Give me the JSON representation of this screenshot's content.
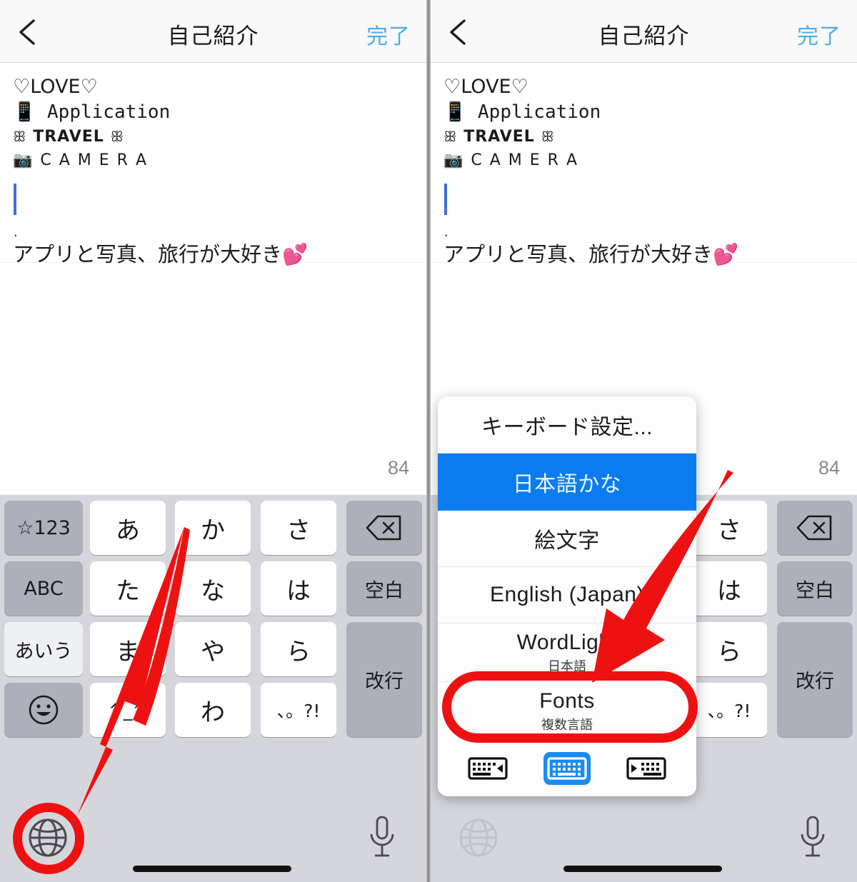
{
  "nav": {
    "back_icon": "chevron-left-icon",
    "title": "自己紹介",
    "done_label": "完了"
  },
  "bio": {
    "lines": [
      {
        "id": "love",
        "text": "♡LOVE♡"
      },
      {
        "id": "app",
        "emoji": "📱",
        "text": "Application"
      },
      {
        "id": "travel",
        "orn_left": "ꕥ",
        "text": "TRAVEL",
        "orn_right": "ꕥ"
      },
      {
        "id": "camera",
        "emoji": "📷",
        "text": "C A M E R A"
      },
      {
        "id": "blank",
        "text": ""
      },
      {
        "id": "dot",
        "text": "."
      },
      {
        "id": "jp",
        "text": "アプリと写真、旅行が大好き",
        "emoji": "💕"
      }
    ],
    "char_count": "84",
    "caret_visible": true
  },
  "keyboard": {
    "rows": [
      [
        {
          "label": "☆123",
          "style": "dark",
          "name": "key-symbols"
        },
        {
          "label": "あ",
          "style": "light",
          "name": "key-a"
        },
        {
          "label": "か",
          "style": "light",
          "name": "key-ka"
        },
        {
          "label": "さ",
          "style": "light",
          "name": "key-sa"
        },
        {
          "label": "⌫",
          "style": "dark",
          "name": "key-delete"
        }
      ],
      [
        {
          "label": "ABC",
          "style": "dark",
          "name": "key-abc"
        },
        {
          "label": "た",
          "style": "light",
          "name": "key-ta"
        },
        {
          "label": "な",
          "style": "light",
          "name": "key-na"
        },
        {
          "label": "は",
          "style": "light",
          "name": "key-ha"
        },
        {
          "label": "空白",
          "style": "dark",
          "name": "key-space"
        }
      ],
      [
        {
          "label": "あいう",
          "style": "pale",
          "name": "key-aiu"
        },
        {
          "label": "ま",
          "style": "light",
          "name": "key-ma"
        },
        {
          "label": "や",
          "style": "light",
          "name": "key-ya"
        },
        {
          "label": "ら",
          "style": "light",
          "name": "key-ra"
        },
        {
          "label": "改行",
          "style": "dark",
          "name": "key-return"
        }
      ],
      [
        {
          "label": "☺",
          "style": "dark",
          "name": "key-emoji"
        },
        {
          "label": "^_^",
          "style": "light",
          "name": "key-kaomoji"
        },
        {
          "label": "わ",
          "style": "light",
          "name": "key-wa"
        },
        {
          "label": "、。?!",
          "style": "light",
          "name": "key-punctuation"
        }
      ]
    ],
    "globe_icon": "globe-icon",
    "mic_icon": "microphone-icon",
    "home_indicator": "home-indicator"
  },
  "popup": {
    "items": [
      {
        "title": "キーボード設定...",
        "sub": "",
        "selected": false,
        "name": "menu-keyboard-settings"
      },
      {
        "title": "日本語かな",
        "sub": "",
        "selected": true,
        "name": "menu-japanese-kana"
      },
      {
        "title": "絵文字",
        "sub": "",
        "selected": false,
        "name": "menu-emoji"
      },
      {
        "title": "English (Japan)",
        "sub": "",
        "selected": false,
        "name": "menu-english-japan"
      },
      {
        "title": "WordLight",
        "sub": "日本語",
        "selected": false,
        "name": "menu-wordlight"
      },
      {
        "title": "Fonts",
        "sub": "複数言語",
        "selected": false,
        "name": "menu-fonts"
      }
    ],
    "switcher": [
      {
        "icon": "keyboard-prev-icon",
        "active": false,
        "name": "keyboard-prev-button"
      },
      {
        "icon": "keyboard-current-icon",
        "active": true,
        "name": "keyboard-current-button"
      },
      {
        "icon": "keyboard-next-icon",
        "active": false,
        "name": "keyboard-next-button"
      }
    ]
  },
  "annotations": {
    "accent_color": "#ee1111",
    "left_arrow": "red-arrow-to-globe",
    "left_circle": "red-circle-globe",
    "right_arrow": "red-arrow-to-fonts",
    "right_oval": "red-oval-fonts"
  },
  "colors": {
    "nav_done": "#4aaee8",
    "selection_blue": "#0a7cf0",
    "annotation_red": "#ee1111",
    "keyboard_bg": "#d4d6dc",
    "key_light": "#ffffff",
    "key_dark": "#adb0ba"
  }
}
